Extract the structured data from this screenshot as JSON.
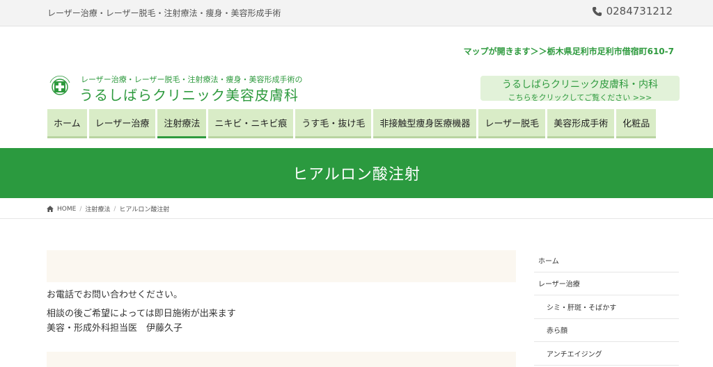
{
  "topbar": {
    "tagline": "レーザー治療・レーザー脱毛・注射療法・痩身・美容形成手術",
    "phone_icon": "phone-icon",
    "phone": "0284731212"
  },
  "address": "マップが開きます＞＞栃木県足利市足利市借宿町610-7",
  "logo": {
    "subtitle": "レーザー治療・レーザー脱毛・注射療法・痩身・美容形成手術の",
    "name": "うるしばらクリニック美容皮膚科",
    "emblem_text": "URUSHIBARA CLINIC",
    "accent": "#2e9a3e"
  },
  "dermatology_button": {
    "line1": "うるしばらクリニック皮膚科・内科",
    "line2": "こちらをクリックしてご覧ください >>>"
  },
  "nav": {
    "items": [
      {
        "label": "ホーム"
      },
      {
        "label": "レーザー治療"
      },
      {
        "label": "注射療法"
      },
      {
        "label": "ニキビ・ニキビ痕"
      },
      {
        "label": "うす毛・抜け毛"
      },
      {
        "label": "非接触型痩身医療機器"
      },
      {
        "label": "レーザー脱毛"
      },
      {
        "label": "美容形成手術"
      },
      {
        "label": "化粧品"
      }
    ],
    "active": "注射療法"
  },
  "hero": {
    "title": "ヒアルロン酸注射",
    "color": "#2b9a3f"
  },
  "breadcrumb": {
    "home_icon": "home-icon",
    "home": "HOME",
    "category": "注射療法",
    "current": "ヒアルロン酸注射"
  },
  "main": {
    "line1": "お電話でお問い合わせください。",
    "line2": "相談の後ご希望によっては即日施術が出来ます",
    "line3": "美容・形成外科担当医　伊藤久子"
  },
  "sidebar": {
    "items": [
      {
        "label": "ホーム"
      },
      {
        "label": "レーザー治療"
      },
      {
        "label": "シミ・肝斑・そばかす"
      },
      {
        "label": "赤ら顔"
      },
      {
        "label": "アンチエイジング"
      }
    ]
  }
}
